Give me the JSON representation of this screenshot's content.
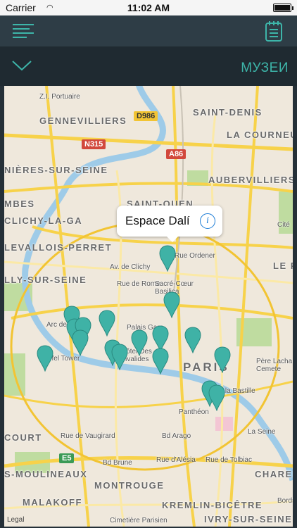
{
  "status_bar": {
    "carrier": "Carrier",
    "time": "11:02 AM"
  },
  "header": {
    "title": "МУЗЕИ"
  },
  "icons": {
    "menu": "menu-lines-icon",
    "notes": "notepad-icon",
    "collapse": "chevron-down-icon",
    "info": "info-icon"
  },
  "colors": {
    "accent": "#3db5a9",
    "navbar": "#2e3d46",
    "subbar": "#1f2a31"
  },
  "map": {
    "labels": {
      "gennevilliers": "GENNEVILLIERS",
      "saint_denis": "SAINT-DENIS",
      "la_courneuve": "LA COURNEUVE",
      "aubervilliers": "AUBERVILLIERS",
      "asnieres": "NIÈRES-SUR-SEINE",
      "zi_portuaire": "Z.I. Portuaire",
      "mbes": "MBES",
      "clichy": "CLICHY-LA-GA",
      "saint_ouen": "SAINT-OUEN",
      "levallois": "LEVALLOIS-PERRET",
      "lly_sur_seine": "LLY-SUR-SEINE",
      "arc_de_triomphe": "Arc de T",
      "eiffel_tower": "Eiffel Tower",
      "palais_garnier": "Palais Garn",
      "sacre_coeur": "Sacré-Cœur Basilica",
      "hotel_invalides": "Hôtel Des Invalides",
      "paris": "PARIS",
      "pere_lachaise": "Père Lacha Cemete",
      "bastille": "de la Bastille",
      "pantheon": "Panthéon",
      "rue_ordener": "Rue Ordener",
      "av_clichy": "Av. de Clichy",
      "rue_de_rome": "Rue de Rome",
      "rue_vaugirard": "Rue de Vaugirard",
      "bd_brune": "Bd Brune",
      "bd_arago": "Bd Arago",
      "rue_alesia": "Rue d'Alésia",
      "rue_tolbiac": "Rue de Tolbiac",
      "la_seine": "La Seine",
      "court": "COURT",
      "moulineaux": "S-MOULINEAUX",
      "montrouge": "MONTROUGE",
      "malakoff": "MALAKOFF",
      "kremlin": "KREMLIN-BICÊTRE",
      "ivry": "IVRY-SUR-SEINE",
      "charenton": "CHARENT",
      "le_pre": "LE PR",
      "cite": "Cité",
      "cimetiere": "Cimetière Parisien",
      "bords": "Bords"
    },
    "shields": {
      "d986": "D986",
      "n315": "N315",
      "a86": "A86",
      "e5": "E5"
    },
    "callout": {
      "name": "Espace Dalí"
    },
    "legal": "Legal"
  }
}
